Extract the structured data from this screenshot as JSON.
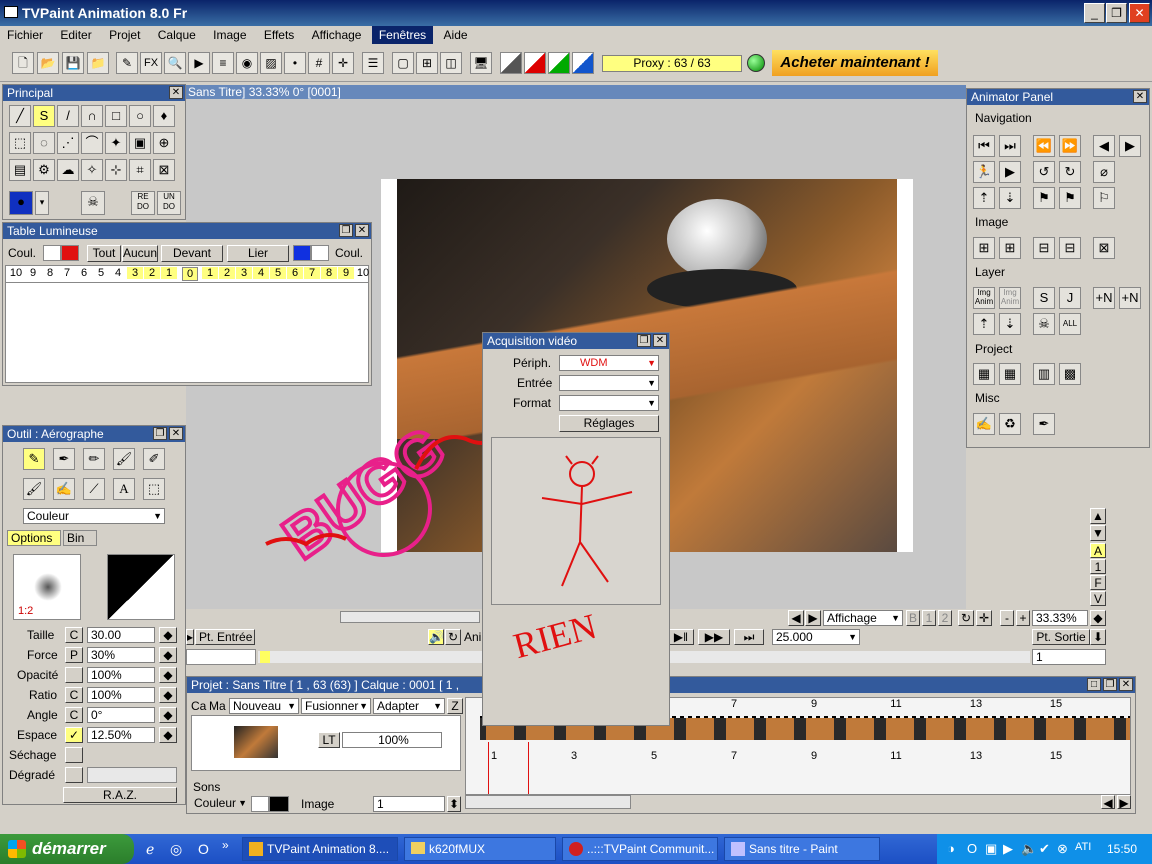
{
  "window": {
    "title": "TVPaint Animation 8.0 Fr",
    "minimize": "_",
    "maximize": "❐",
    "close": "✕"
  },
  "menu": [
    "Fichier",
    "Editer",
    "Projet",
    "Calque",
    "Image",
    "Effets",
    "Affichage",
    "Fenêtres",
    "Aide"
  ],
  "toolbar": {
    "fx_label": "FX",
    "proxy": "Proxy : 63 / 63",
    "buy": "Acheter maintenant !"
  },
  "canvas": {
    "info": "Sans Titre]  33.33%   0°  [0001]",
    "doodle": "BUGG"
  },
  "principal": {
    "title": "Principal",
    "redo": "RE DO",
    "undo": "UN DO"
  },
  "lightbox": {
    "title": "Table Lumineuse",
    "coul_left": "Coul.",
    "coul_right": "Coul.",
    "tout": "Tout",
    "aucun": "Aucun",
    "devant": "Devant",
    "lier": "Lier",
    "left_numbers": [
      "10",
      "9",
      "8",
      "7",
      "6",
      "5",
      "4",
      "3",
      "2",
      "1"
    ],
    "center_number": "0",
    "right_numbers": [
      "1",
      "2",
      "3",
      "4",
      "5",
      "6",
      "7",
      "8",
      "9",
      "10"
    ]
  },
  "tool_panel": {
    "title": "Outil : Aérographe",
    "mode": "Couleur",
    "tab_options": "Options",
    "tab_bin": "Bin",
    "ratio_label": "1:2",
    "rows": [
      {
        "label": "Taille",
        "flag": "C",
        "value": "30.00"
      },
      {
        "label": "Force",
        "flag": "P",
        "value": "30%"
      },
      {
        "label": "Opacité",
        "flag": "",
        "value": "100%"
      },
      {
        "label": "Ratio",
        "flag": "C",
        "value": "100%"
      },
      {
        "label": "Angle",
        "flag": "C",
        "value": "0°"
      },
      {
        "label": "Espace",
        "flag": "✓",
        "value": "12.50%"
      },
      {
        "label": "Séchage",
        "flag": "",
        "value": ""
      },
      {
        "label": "Dégradé",
        "flag": "",
        "value": ""
      }
    ],
    "raz": "R.A.Z."
  },
  "acquisition": {
    "title": "Acquisition vidéo",
    "periph": "Périph.",
    "entree": "Entrée",
    "format": "Format",
    "reglages": "Réglages",
    "scribble_periph": "WDM",
    "rien": "RIEN"
  },
  "animator": {
    "title": "Animator Panel",
    "sections": [
      "Navigation",
      "Image",
      "Layer",
      "Project",
      "Misc"
    ],
    "img_anim": "Img Anim",
    "all": "ALL"
  },
  "playback": {
    "affichage": "Affichage",
    "zoom": "33.33%",
    "pt_entree": "Pt. Entrée",
    "pt_sortie": "Pt. Sortie",
    "fps": "25.000",
    "frame": "1",
    "anim_partial": "Ani",
    "side_letters": [
      "A",
      "1",
      "F",
      "V"
    ]
  },
  "timeline": {
    "title": "Projet : Sans Titre [ 1 , 63  (63) ]      Calque : 0001 [ 1 ,",
    "cols": [
      "Ca",
      "Ma",
      "Nouveau",
      "Fusionner",
      "Adapter",
      "Z"
    ],
    "lt": "LT",
    "opacity": "100%",
    "sons": "Sons",
    "couleur": "Couleur",
    "image": "Image",
    "image_value": "1",
    "ticks_top": [
      "7",
      "9",
      "11",
      "13",
      "15"
    ],
    "ticks_bottom": [
      "1",
      "3",
      "5",
      "7",
      "9",
      "11",
      "13",
      "15"
    ]
  },
  "taskbar": {
    "start": "démarrer",
    "tasks": [
      "TVPaint Animation 8....",
      "k620fMUX",
      "..:::TVPaint Communit...",
      "Sans titre - Paint"
    ],
    "clock": "15:50"
  }
}
